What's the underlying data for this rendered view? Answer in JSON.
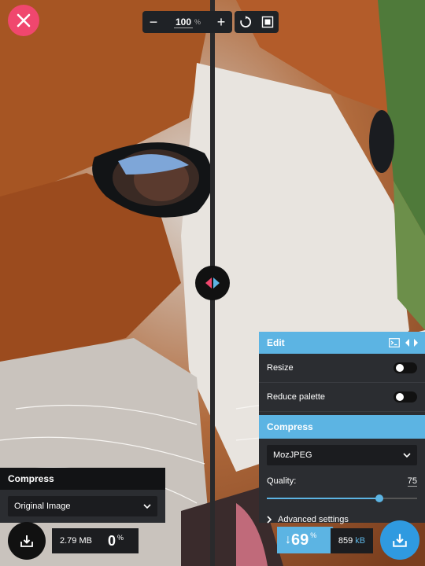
{
  "zoom": {
    "minus": "−",
    "value": "100",
    "unit": "%",
    "plus": "+"
  },
  "edit_panel": {
    "title": "Edit",
    "resize_label": "Resize",
    "reduce_palette_label": "Reduce palette",
    "compress_title": "Compress",
    "codec": "MozJPEG",
    "quality_label": "Quality:",
    "quality_value": "75",
    "quality_fraction": 0.75,
    "advanced_label": "Advanced settings"
  },
  "left_panel": {
    "title": "Compress",
    "codec": "Original Image",
    "size": "2.79 MB",
    "percent": "0",
    "percent_unit": "%"
  },
  "result": {
    "arrow": "↓",
    "percent": "69",
    "percent_unit": "%",
    "size_value": "859",
    "size_unit": "kB"
  },
  "colors": {
    "accent": "#5cb4e3",
    "close": "#f0476e",
    "panel": "#2b2d31"
  }
}
